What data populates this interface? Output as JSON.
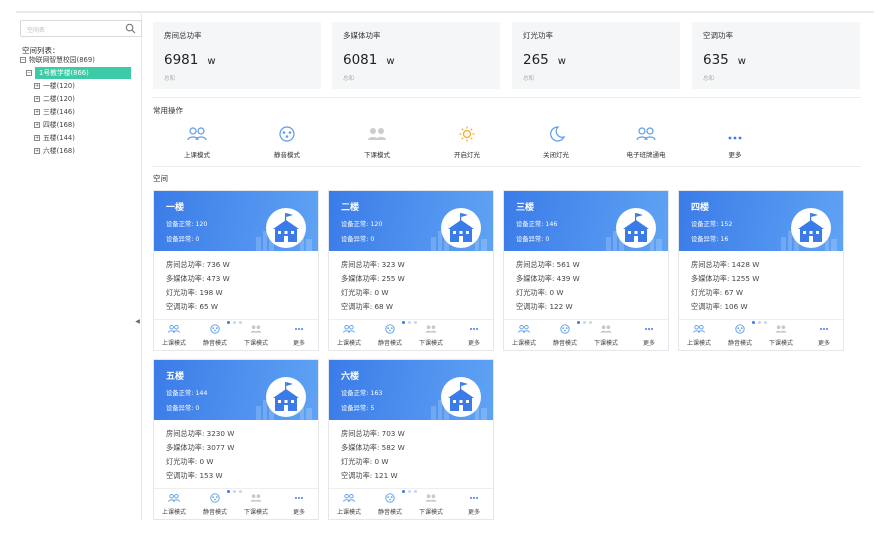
{
  "sidebar": {
    "search_placeholder": "空间名",
    "list_title": "空间列表：",
    "root": "物联网智慧校园(869)",
    "selected": "1号教学楼(866)",
    "floors": [
      "一楼(120)",
      "二楼(120)",
      "三楼(146)",
      "四楼(168)",
      "五楼(144)",
      "六楼(168)"
    ]
  },
  "stats": [
    {
      "title": "房间总功率",
      "value": "6981",
      "unit": "w",
      "sub": "总和"
    },
    {
      "title": "多媒体功率",
      "value": "6081",
      "unit": "w",
      "sub": "总和"
    },
    {
      "title": "灯光功率",
      "value": "265",
      "unit": "w",
      "sub": "总和"
    },
    {
      "title": "空调功率",
      "value": "635",
      "unit": "w",
      "sub": "总和"
    }
  ],
  "ops": {
    "title": "常用操作",
    "items": [
      {
        "label": "上课模式",
        "icon": "people-icon"
      },
      {
        "label": "静音模式",
        "icon": "mute-icon"
      },
      {
        "label": "下课模式",
        "icon": "people-gray-icon"
      },
      {
        "label": "开启灯光",
        "icon": "sun-icon"
      },
      {
        "label": "关闭灯光",
        "icon": "moon-icon"
      },
      {
        "label": "电子班牌通电",
        "icon": "people-icon"
      },
      {
        "label": "更多",
        "icon": "more-icon"
      }
    ]
  },
  "space": {
    "title": "空间",
    "labels": {
      "normal": "设备正常: ",
      "abnormal": "设备异常: ",
      "room": "房间总功率: ",
      "media": "多媒体功率: ",
      "light": "灯光功率: ",
      "ac": "空调功率: "
    },
    "actions": [
      "上课模式",
      "静音模式",
      "下课模式",
      "更多"
    ],
    "cards": [
      {
        "name": "一楼",
        "normal": "120",
        "abnormal": "0",
        "room": "736 W",
        "media": "473 W",
        "light": "198 W",
        "ac": "65 W"
      },
      {
        "name": "二楼",
        "normal": "120",
        "abnormal": "0",
        "room": "323 W",
        "media": "255 W",
        "light": "0 W",
        "ac": "68 W"
      },
      {
        "name": "三楼",
        "normal": "146",
        "abnormal": "0",
        "room": "561 W",
        "media": "439 W",
        "light": "0 W",
        "ac": "122 W"
      },
      {
        "name": "四楼",
        "normal": "152",
        "abnormal": "16",
        "room": "1428 W",
        "media": "1255 W",
        "light": "67 W",
        "ac": "106 W"
      },
      {
        "name": "五楼",
        "normal": "144",
        "abnormal": "0",
        "room": "3230 W",
        "media": "3077 W",
        "light": "0 W",
        "ac": "153 W"
      },
      {
        "name": "六楼",
        "normal": "163",
        "abnormal": "5",
        "room": "703 W",
        "media": "582 W",
        "light": "0 W",
        "ac": "121 W"
      }
    ]
  },
  "colors": {
    "accent": "#3b7be8",
    "selected": "#3ccba6",
    "icon": "#5a9bea"
  }
}
